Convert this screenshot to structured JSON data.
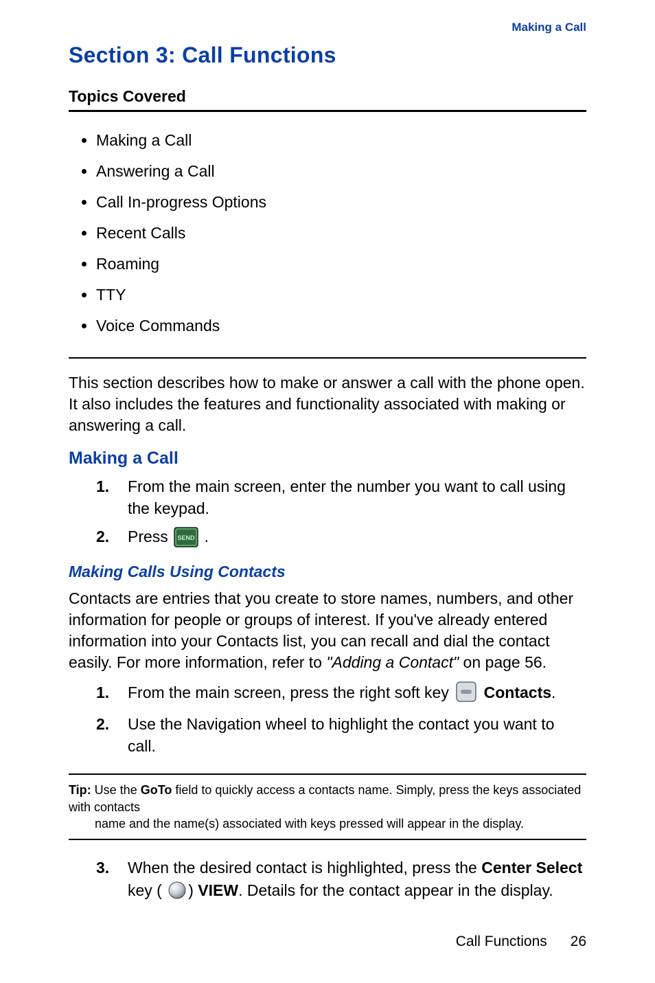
{
  "breadcrumb": "Making a Call",
  "section_title": "Section 3: Call Functions",
  "topics_label": "Topics Covered",
  "topics": [
    "Making a Call",
    "Answering a Call",
    "Call In-progress Options",
    "Recent Calls",
    "Roaming",
    "TTY",
    "Voice Commands"
  ],
  "intro": "This section describes how to make or answer a call with the phone open. It also includes the features and functionality associated with making or answering a call.",
  "making_call_head": "Making a Call",
  "step_nums": {
    "n1": "1.",
    "n2": "2.",
    "n3": "3."
  },
  "step1": "From the main screen, enter the number you want to call using the keypad.",
  "step2_press": "Press ",
  "step2_period": ".",
  "contacts_head": "Making Calls Using Contacts",
  "contacts_para_a": "Contacts are entries that you create to store names, numbers, and other information for people or groups of interest. If you've already entered information into your Contacts list, you can recall and dial the contact easily. For more information, refer to ",
  "contacts_para_ref": "\"Adding a Contact\"",
  "contacts_para_c": "  on page 56.",
  "cstep1_a": "From the main screen, press the right soft key ",
  "cstep1_b": " ",
  "cstep1_contacts": "Contacts",
  "cstep1_c": ".",
  "cstep2": "Use the Navigation wheel to highlight the contact you want to call.",
  "tip_label": "Tip:",
  "tip_line1": " Use the ",
  "tip_goto": "GoTo",
  "tip_line1b": " field to quickly access a contacts name. Simply, press the keys associated with contacts ",
  "tip_line2": "name and the name(s) associated with keys pressed will appear in the display.",
  "cstep3_a": "When the desired contact is highlighted, press the ",
  "cstep3_cs": "Center Select",
  "cstep3_b": " key (",
  "cstep3_c": ") ",
  "cstep3_view": "VIEW",
  "cstep3_d": ". Details for the contact appear in the display.",
  "footer_text": "Call Functions",
  "footer_page": "26"
}
